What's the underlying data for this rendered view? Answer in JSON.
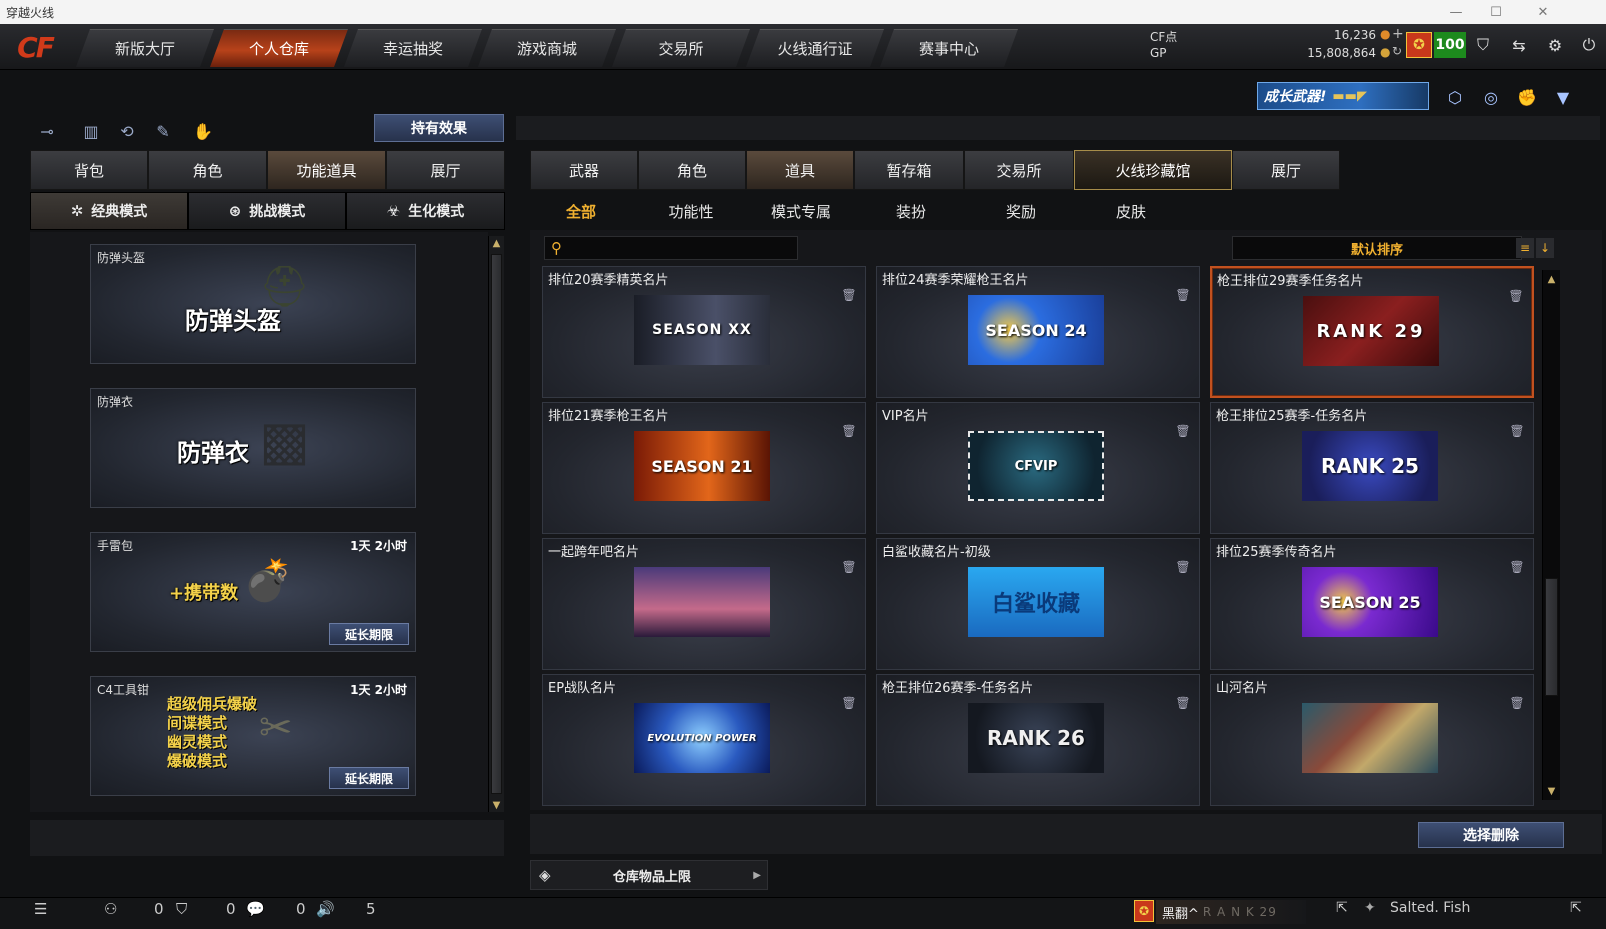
{
  "window": {
    "title": "穿越火线",
    "min": "—",
    "max": "☐",
    "close": "✕"
  },
  "nav": {
    "logo": "CF",
    "tabs": [
      {
        "label": "新版大厅"
      },
      {
        "label": "个人仓库",
        "active": true
      },
      {
        "label": "幸运抽奖"
      },
      {
        "label": "游戏商城"
      },
      {
        "label": "交易所"
      },
      {
        "label": "火线通行证"
      },
      {
        "label": "赛事中心"
      }
    ]
  },
  "currency": {
    "cf_label": "CF点",
    "cf_value": "16,236",
    "gp_label": "GP",
    "gp_value": "15,808,864",
    "badge_value": "100",
    "plus": "+"
  },
  "banner": {
    "text": "成长武器!"
  },
  "left": {
    "effect_button": "持有效果",
    "tabs": [
      {
        "label": "背包"
      },
      {
        "label": "角色"
      },
      {
        "label": "功能道具",
        "active": true
      },
      {
        "label": "展厅"
      }
    ],
    "modes": [
      {
        "label": "经典模式",
        "icon": "✲",
        "active": true
      },
      {
        "label": "挑战模式",
        "icon": "⊛"
      },
      {
        "label": "生化模式",
        "icon": "☣"
      }
    ],
    "items": [
      {
        "label": "防弹头盔",
        "big": "防弹头盔",
        "time": "",
        "extend": ""
      },
      {
        "label": "防弹衣",
        "big": "防弹衣",
        "time": "",
        "extend": ""
      },
      {
        "label": "手雷包",
        "big": "+携带数",
        "time": "1天 2小时",
        "extend": "延长期限"
      },
      {
        "label": "C4工具钳",
        "lines": [
          "超级佣兵爆破",
          "间谍模式",
          "幽灵模式",
          "爆破模式"
        ],
        "time": "1天 2小时",
        "extend": "延长期限"
      }
    ]
  },
  "right": {
    "tabs": [
      {
        "label": "武器"
      },
      {
        "label": "角色"
      },
      {
        "label": "道具",
        "active": true
      },
      {
        "label": "暂存箱"
      },
      {
        "label": "交易所"
      },
      {
        "label": "火线珍藏馆",
        "gold": true
      },
      {
        "label": "展厅"
      }
    ],
    "filters": [
      {
        "label": "全部",
        "active": true
      },
      {
        "label": "功能性"
      },
      {
        "label": "模式专属"
      },
      {
        "label": "装扮"
      },
      {
        "label": "奖励"
      },
      {
        "label": "皮肤"
      }
    ],
    "search_placeholder": "",
    "sort_label": "默认排序",
    "cards": [
      {
        "title": "排位20赛季精英名片",
        "img_text": "SEASON XX",
        "style": "s20"
      },
      {
        "title": "排位24赛季荣耀枪王名片",
        "img_text": "SEASON 24",
        "style": "s24"
      },
      {
        "title": "枪王排位29赛季任务名片",
        "img_text": "RANK 29",
        "style": "r29",
        "selected": true
      },
      {
        "title": "排位21赛季枪王名片",
        "img_text": "SEASON 21",
        "style": "s21"
      },
      {
        "title": "VIP名片",
        "img_text": "CFVIP",
        "style": "vip"
      },
      {
        "title": "枪王排位25赛季-任务名片",
        "img_text": "RANK 25",
        "style": "r25"
      },
      {
        "title": "一起跨年吧名片",
        "img_text": "",
        "style": "newyear"
      },
      {
        "title": "白鲨收藏名片-初级",
        "img_text": "白鲨收藏",
        "style": "shark"
      },
      {
        "title": "排位25赛季传奇名片",
        "img_text": "SEASON 25",
        "style": "s25"
      },
      {
        "title": "EP战队名片",
        "img_text": "EVOLUTION POWER",
        "style": "ep"
      },
      {
        "title": "枪王排位26赛季-任务名片",
        "img_text": "RANK 26",
        "style": "r26"
      },
      {
        "title": "山河名片",
        "img_text": "",
        "style": "shanhe"
      }
    ],
    "delete_button": "选择删除",
    "storage_limit": "仓库物品上限"
  },
  "bottom": {
    "count1": "0",
    "count2": "0",
    "count3": "0",
    "count4": "5",
    "player_name": "黑翻^",
    "rank_text": "R A N K 29",
    "friend_name": "Salted. Fish"
  },
  "colors": {
    "accent": "#b8421a",
    "gold": "#f0b030",
    "blue_button": "#27324c"
  }
}
